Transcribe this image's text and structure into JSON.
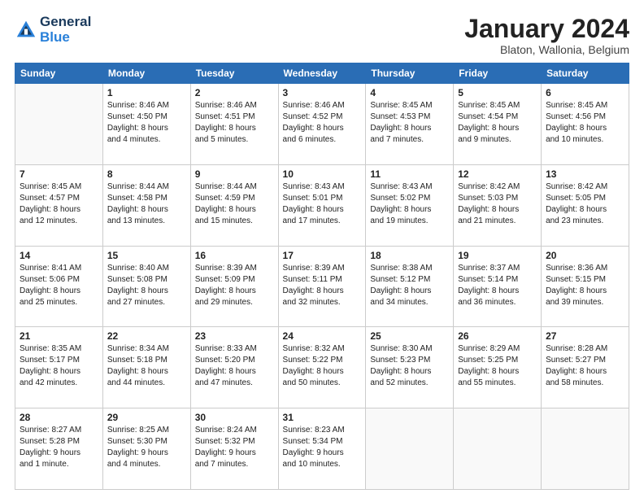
{
  "header": {
    "logo_general": "General",
    "logo_blue": "Blue",
    "month": "January 2024",
    "location": "Blaton, Wallonia, Belgium"
  },
  "days_of_week": [
    "Sunday",
    "Monday",
    "Tuesday",
    "Wednesday",
    "Thursday",
    "Friday",
    "Saturday"
  ],
  "weeks": [
    [
      {
        "day": "",
        "info": ""
      },
      {
        "day": "1",
        "info": "Sunrise: 8:46 AM\nSunset: 4:50 PM\nDaylight: 8 hours\nand 4 minutes."
      },
      {
        "day": "2",
        "info": "Sunrise: 8:46 AM\nSunset: 4:51 PM\nDaylight: 8 hours\nand 5 minutes."
      },
      {
        "day": "3",
        "info": "Sunrise: 8:46 AM\nSunset: 4:52 PM\nDaylight: 8 hours\nand 6 minutes."
      },
      {
        "day": "4",
        "info": "Sunrise: 8:45 AM\nSunset: 4:53 PM\nDaylight: 8 hours\nand 7 minutes."
      },
      {
        "day": "5",
        "info": "Sunrise: 8:45 AM\nSunset: 4:54 PM\nDaylight: 8 hours\nand 9 minutes."
      },
      {
        "day": "6",
        "info": "Sunrise: 8:45 AM\nSunset: 4:56 PM\nDaylight: 8 hours\nand 10 minutes."
      }
    ],
    [
      {
        "day": "7",
        "info": "Sunrise: 8:45 AM\nSunset: 4:57 PM\nDaylight: 8 hours\nand 12 minutes."
      },
      {
        "day": "8",
        "info": "Sunrise: 8:44 AM\nSunset: 4:58 PM\nDaylight: 8 hours\nand 13 minutes."
      },
      {
        "day": "9",
        "info": "Sunrise: 8:44 AM\nSunset: 4:59 PM\nDaylight: 8 hours\nand 15 minutes."
      },
      {
        "day": "10",
        "info": "Sunrise: 8:43 AM\nSunset: 5:01 PM\nDaylight: 8 hours\nand 17 minutes."
      },
      {
        "day": "11",
        "info": "Sunrise: 8:43 AM\nSunset: 5:02 PM\nDaylight: 8 hours\nand 19 minutes."
      },
      {
        "day": "12",
        "info": "Sunrise: 8:42 AM\nSunset: 5:03 PM\nDaylight: 8 hours\nand 21 minutes."
      },
      {
        "day": "13",
        "info": "Sunrise: 8:42 AM\nSunset: 5:05 PM\nDaylight: 8 hours\nand 23 minutes."
      }
    ],
    [
      {
        "day": "14",
        "info": "Sunrise: 8:41 AM\nSunset: 5:06 PM\nDaylight: 8 hours\nand 25 minutes."
      },
      {
        "day": "15",
        "info": "Sunrise: 8:40 AM\nSunset: 5:08 PM\nDaylight: 8 hours\nand 27 minutes."
      },
      {
        "day": "16",
        "info": "Sunrise: 8:39 AM\nSunset: 5:09 PM\nDaylight: 8 hours\nand 29 minutes."
      },
      {
        "day": "17",
        "info": "Sunrise: 8:39 AM\nSunset: 5:11 PM\nDaylight: 8 hours\nand 32 minutes."
      },
      {
        "day": "18",
        "info": "Sunrise: 8:38 AM\nSunset: 5:12 PM\nDaylight: 8 hours\nand 34 minutes."
      },
      {
        "day": "19",
        "info": "Sunrise: 8:37 AM\nSunset: 5:14 PM\nDaylight: 8 hours\nand 36 minutes."
      },
      {
        "day": "20",
        "info": "Sunrise: 8:36 AM\nSunset: 5:15 PM\nDaylight: 8 hours\nand 39 minutes."
      }
    ],
    [
      {
        "day": "21",
        "info": "Sunrise: 8:35 AM\nSunset: 5:17 PM\nDaylight: 8 hours\nand 42 minutes."
      },
      {
        "day": "22",
        "info": "Sunrise: 8:34 AM\nSunset: 5:18 PM\nDaylight: 8 hours\nand 44 minutes."
      },
      {
        "day": "23",
        "info": "Sunrise: 8:33 AM\nSunset: 5:20 PM\nDaylight: 8 hours\nand 47 minutes."
      },
      {
        "day": "24",
        "info": "Sunrise: 8:32 AM\nSunset: 5:22 PM\nDaylight: 8 hours\nand 50 minutes."
      },
      {
        "day": "25",
        "info": "Sunrise: 8:30 AM\nSunset: 5:23 PM\nDaylight: 8 hours\nand 52 minutes."
      },
      {
        "day": "26",
        "info": "Sunrise: 8:29 AM\nSunset: 5:25 PM\nDaylight: 8 hours\nand 55 minutes."
      },
      {
        "day": "27",
        "info": "Sunrise: 8:28 AM\nSunset: 5:27 PM\nDaylight: 8 hours\nand 58 minutes."
      }
    ],
    [
      {
        "day": "28",
        "info": "Sunrise: 8:27 AM\nSunset: 5:28 PM\nDaylight: 9 hours\nand 1 minute."
      },
      {
        "day": "29",
        "info": "Sunrise: 8:25 AM\nSunset: 5:30 PM\nDaylight: 9 hours\nand 4 minutes."
      },
      {
        "day": "30",
        "info": "Sunrise: 8:24 AM\nSunset: 5:32 PM\nDaylight: 9 hours\nand 7 minutes."
      },
      {
        "day": "31",
        "info": "Sunrise: 8:23 AM\nSunset: 5:34 PM\nDaylight: 9 hours\nand 10 minutes."
      },
      {
        "day": "",
        "info": ""
      },
      {
        "day": "",
        "info": ""
      },
      {
        "day": "",
        "info": ""
      }
    ]
  ]
}
